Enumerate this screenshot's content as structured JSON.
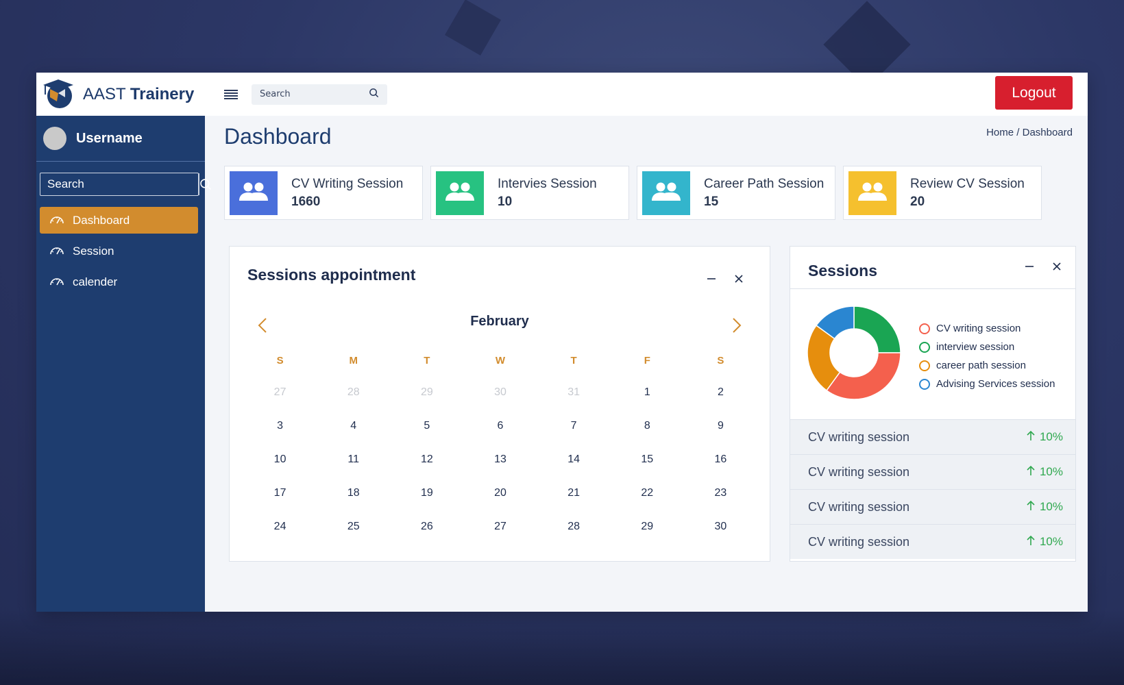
{
  "brand": {
    "prefix": "AAST",
    "name": "Trainery"
  },
  "topbar": {
    "search_placeholder": "Search",
    "logout_label": "Logout"
  },
  "sidebar": {
    "username": "Username",
    "search_placeholder": "Search",
    "items": [
      {
        "label": "Dashboard",
        "active": true
      },
      {
        "label": "Session",
        "active": false
      },
      {
        "label": "calender",
        "active": false
      }
    ]
  },
  "page": {
    "title": "Dashboard",
    "breadcrumb": "Home / Dashboard"
  },
  "stats": [
    {
      "label": "CV Writing Session",
      "value": "1660",
      "color": "#4a6fdb"
    },
    {
      "label": "Intervies Session",
      "value": "10",
      "color": "#27c281"
    },
    {
      "label": "Career Path Session",
      "value": "15",
      "color": "#33b5cc"
    },
    {
      "label": "Review CV Session",
      "value": "20",
      "color": "#f5c02e"
    }
  ],
  "calendar": {
    "title": "Sessions appointment",
    "month": "February",
    "weekdays": [
      "S",
      "M",
      "T",
      "W",
      "T",
      "F",
      "S"
    ],
    "weeks": [
      [
        "27",
        "28",
        "29",
        "30",
        "31",
        "1",
        "2"
      ],
      [
        "3",
        "4",
        "5",
        "6",
        "7",
        "8",
        "9"
      ],
      [
        "10",
        "11",
        "12",
        "13",
        "14",
        "15",
        "16"
      ],
      [
        "17",
        "18",
        "19",
        "20",
        "21",
        "22",
        "23"
      ],
      [
        "24",
        "25",
        "26",
        "27",
        "28",
        "29",
        "30"
      ]
    ],
    "muted_first_row_count": 5
  },
  "sessions": {
    "title": "Sessions",
    "legend": [
      {
        "label": "CV writing session",
        "color": "#f4604d"
      },
      {
        "label": "interview session",
        "color": "#1aa553"
      },
      {
        "label": "career path session",
        "color": "#e68e0d"
      },
      {
        "label": "Advising Services session",
        "color": "#2a86d1"
      }
    ],
    "donut_shares": {
      "interview": 0.25,
      "cv_writing": 0.35,
      "career_path": 0.25,
      "advising": 0.15
    },
    "rows": [
      {
        "label": "CV writing session",
        "change": "10%"
      },
      {
        "label": "CV writing session",
        "change": "10%"
      },
      {
        "label": "CV writing session",
        "change": "10%"
      },
      {
        "label": "CV writing session",
        "change": "10%"
      }
    ]
  }
}
